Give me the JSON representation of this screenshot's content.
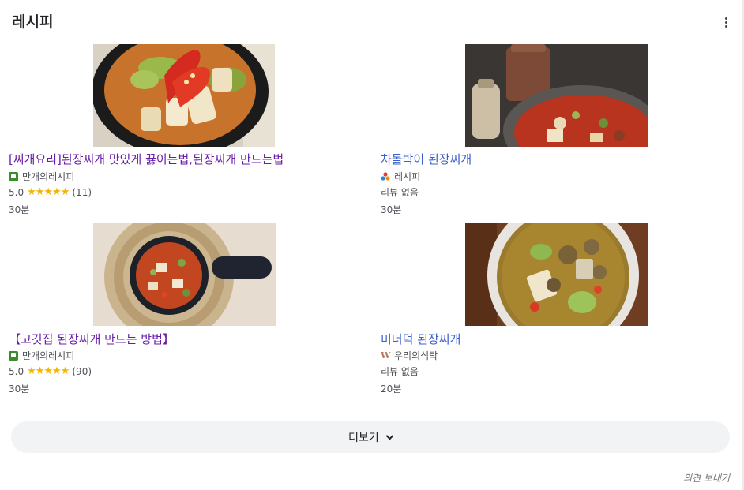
{
  "panel": {
    "title": "레시피",
    "more_options_icon": "vertical-dots-icon"
  },
  "recipes": [
    {
      "title": "[찌개요리]된장찌개 맛있게 끓이는법,된장찌개 만드는법",
      "source": "만개의레시피",
      "source_icon": "recipe-site-icon",
      "rating": "5.0",
      "stars": "★★★★★",
      "reviews": "(11)",
      "time": "30분",
      "visited": true
    },
    {
      "title": "차돌박이 된장찌개",
      "source": "레시피",
      "source_icon": "cj-logo-icon",
      "reviews_text": "리뷰 없음",
      "time": "30분",
      "visited": false
    },
    {
      "title": "【고깃집 된장찌개 만드는 방법】",
      "source": "만개의레시피",
      "source_icon": "recipe-site-icon",
      "rating": "5.0",
      "stars": "★★★★★",
      "reviews": "(90)",
      "time": "30분",
      "visited": true
    },
    {
      "title": "미더덕 된장찌개",
      "source": "우리의식탁",
      "source_icon": "w-logo-icon",
      "source_icon_text": "W",
      "reviews_text": "리뷰 없음",
      "time": "20분",
      "visited": false
    }
  ],
  "more_button": {
    "label": "더보기",
    "icon": "chevron-down-icon"
  },
  "feedback": {
    "label": "의견 보내기"
  },
  "colors": {
    "visited_link": "#681da8",
    "link": "#3b5fc9",
    "star": "#f5b400",
    "button_bg": "#f1f3f4"
  }
}
